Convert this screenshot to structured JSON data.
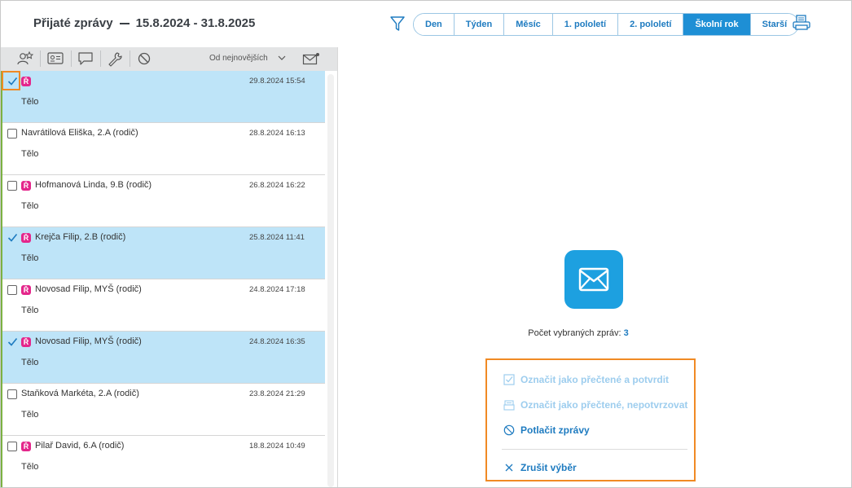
{
  "header": {
    "title": "Přijaté zprávy",
    "date_range": "15.8.2024 - 31.8.2025",
    "periods": [
      "Den",
      "Týden",
      "Měsíc",
      "1. pololetí",
      "2. pololetí",
      "Školní rok",
      "Starší"
    ],
    "active_period": "Školní rok"
  },
  "toolbar": {
    "sort_label": "Od nejnovějších"
  },
  "messages": [
    {
      "sender": "",
      "date": "29.8.2024 15:54",
      "body": "Tělo",
      "selected": true,
      "badge": "Ř"
    },
    {
      "sender": "Navrátilová Eliška, 2.A (rodič)",
      "date": "28.8.2024 16:13",
      "body": "Tělo",
      "selected": false,
      "badge": ""
    },
    {
      "sender": "Hofmanová Linda, 9.B (rodič)",
      "date": "26.8.2024 16:22",
      "body": "Tělo",
      "selected": false,
      "badge": "Ř"
    },
    {
      "sender": "Krejča Filip, 2.B (rodič)",
      "date": "25.8.2024 11:41",
      "body": "Tělo",
      "selected": true,
      "badge": "Ř"
    },
    {
      "sender": "Novosad Filip, MYŠ (rodič)",
      "date": "24.8.2024 17:18",
      "body": "Tělo",
      "selected": false,
      "badge": "Ř"
    },
    {
      "sender": "Novosad Filip, MYŠ (rodič)",
      "date": "24.8.2024 16:35",
      "body": "Tělo",
      "selected": true,
      "badge": "Ř"
    },
    {
      "sender": "Staňková Markéta, 2.A (rodič)",
      "date": "23.8.2024 21:29",
      "body": "Tělo",
      "selected": false,
      "badge": ""
    },
    {
      "sender": "Pilař David, 6.A (rodič)",
      "date": "18.8.2024 10:49",
      "body": "Tělo",
      "selected": false,
      "badge": "Ř"
    }
  ],
  "selection": {
    "count_label": "Počet vybraných zpráv:",
    "count": "3"
  },
  "actions": {
    "mark_read_confirm": "Označit jako přečtené a potvrdit",
    "mark_read_unconfirmed": "Označit jako přečtené, nepotvrzovat",
    "suppress": "Potlačit zprávy",
    "cancel_selection": "Zrušit výběr"
  },
  "colors": {
    "accent": "#1e8fd5",
    "selected_row": "#bee4f8",
    "badge": "#e4268b",
    "highlight": "#f08a24"
  }
}
